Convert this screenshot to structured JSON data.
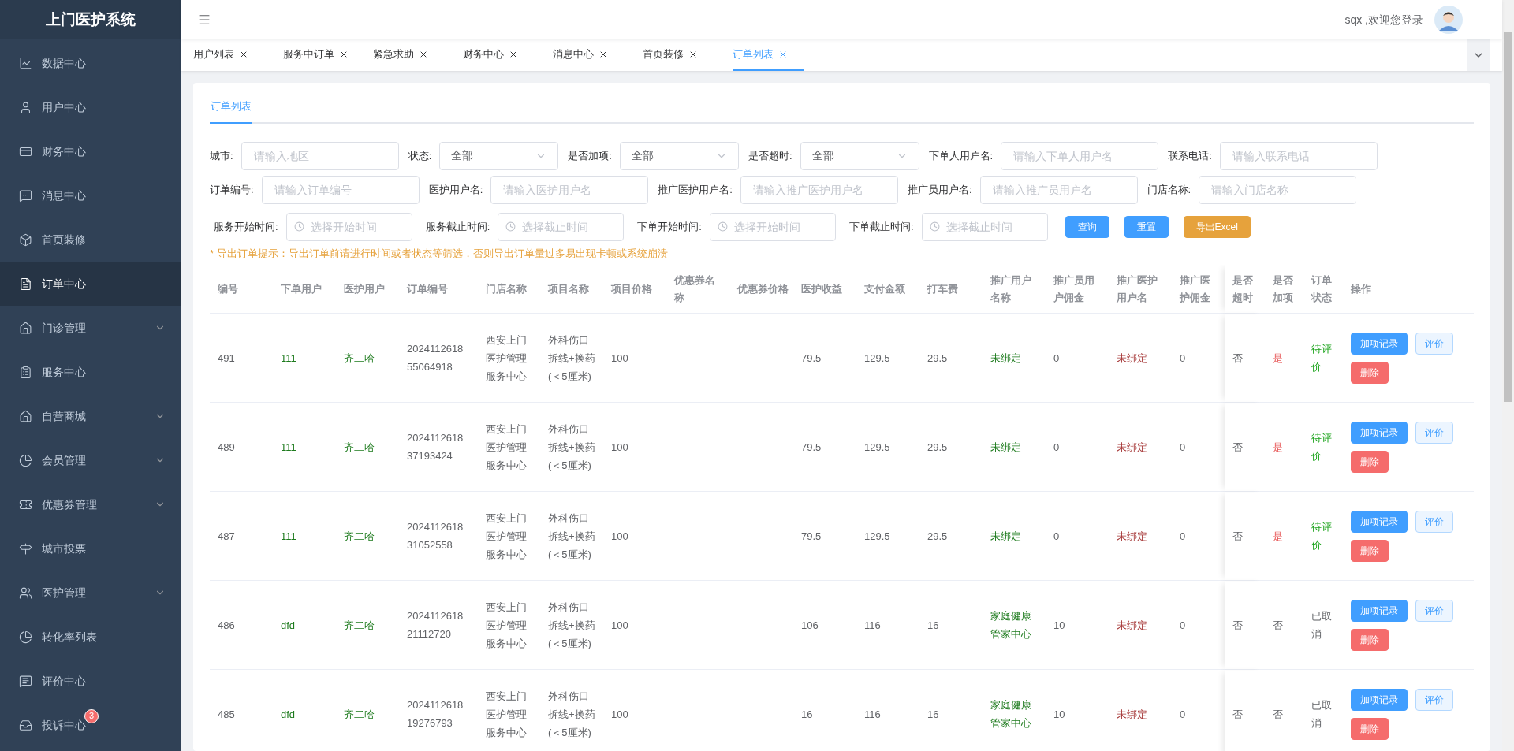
{
  "sidebar": {
    "title": "上门医护系统",
    "items": [
      {
        "label": "数据中心",
        "selected": false,
        "expandable": false
      },
      {
        "label": "用户中心",
        "selected": false,
        "expandable": false
      },
      {
        "label": "财务中心",
        "selected": false,
        "expandable": false
      },
      {
        "label": "消息中心",
        "selected": false,
        "expandable": false
      },
      {
        "label": "首页装修",
        "selected": false,
        "expandable": false
      },
      {
        "label": "订单中心",
        "selected": true,
        "expandable": false
      },
      {
        "label": "门诊管理",
        "selected": false,
        "expandable": true
      },
      {
        "label": "服务中心",
        "selected": false,
        "expandable": false
      },
      {
        "label": "自营商城",
        "selected": false,
        "expandable": true
      },
      {
        "label": "会员管理",
        "selected": false,
        "expandable": true
      },
      {
        "label": "优惠券管理",
        "selected": false,
        "expandable": true
      },
      {
        "label": "城市投票",
        "selected": false,
        "expandable": false
      },
      {
        "label": "医护管理",
        "selected": false,
        "expandable": true
      },
      {
        "label": "转化率列表",
        "selected": false,
        "expandable": false
      },
      {
        "label": "评价中心",
        "selected": false,
        "expandable": false
      },
      {
        "label": "投诉中心",
        "selected": false,
        "expandable": false,
        "badge": "3"
      }
    ]
  },
  "header": {
    "welcome": "sqx ,欢迎您登录"
  },
  "tabs": [
    {
      "label": "用户列表",
      "selected": false
    },
    {
      "label": "服务中订单",
      "selected": false
    },
    {
      "label": "紧急求助",
      "selected": false
    },
    {
      "label": "财务中心",
      "selected": false
    },
    {
      "label": "消息中心",
      "selected": false
    },
    {
      "label": "首页装修",
      "selected": false
    },
    {
      "label": "订单列表",
      "selected": true
    }
  ],
  "panel_tab": {
    "label": "订单列表",
    "selected": true
  },
  "filters": [
    [
      {
        "label": "城市:",
        "kind": "text",
        "placeholder": "请输入地区"
      },
      {
        "label": "状态:",
        "kind": "select",
        "value": "全部"
      },
      {
        "label": "是否加项:",
        "kind": "select",
        "value": "全部"
      },
      {
        "label": "是否超时:",
        "kind": "select",
        "value": "全部"
      },
      {
        "label": "下单人用户名:",
        "kind": "text",
        "placeholder": "请输入下单人用户名"
      },
      {
        "label": "联系电话:",
        "kind": "text",
        "placeholder": "请输入联系电话"
      }
    ],
    [
      {
        "label": "订单编号:",
        "kind": "text",
        "placeholder": "请输入订单编号"
      },
      {
        "label": "医护用户名:",
        "kind": "text",
        "placeholder": "请输入医护用户名"
      },
      {
        "label": "推广医护用户名:",
        "kind": "text",
        "placeholder": "请输入推广医护用户名"
      },
      {
        "label": "推广员用户名:",
        "kind": "text",
        "placeholder": "请输入推广员用户名"
      },
      {
        "label": "门店名称:",
        "kind": "text",
        "placeholder": "请输入门店名称"
      }
    ],
    [
      {
        "label": "服务开始时间:",
        "kind": "date",
        "placeholder": "选择开始时间"
      },
      {
        "label": "服务截止时间:",
        "kind": "date",
        "placeholder": "选择截止时间"
      },
      {
        "label": "下单开始时间:",
        "kind": "date",
        "placeholder": "选择开始时间"
      },
      {
        "label": "下单截止时间:",
        "kind": "date",
        "placeholder": "选择截止时间"
      }
    ]
  ],
  "filter_buttons": [
    {
      "label": "查询",
      "kind": "primary"
    },
    {
      "label": "重置",
      "kind": "primary"
    },
    {
      "label": "导出Excel",
      "kind": "warning"
    }
  ],
  "notice": "* 导出订单提示：导出订单前请进行时间或者状态等筛选，否则导出订单量过多易出现卡顿或系统崩溃",
  "table": {
    "columns": [
      "编号",
      "下单用户",
      "医护用户",
      "订单编号",
      "门店名称",
      "项目名称",
      "项目价格",
      "优惠券名称",
      "优惠券价格",
      "医护收益",
      "支付金额",
      "打车费",
      "推广用户名称",
      "推广员用户佣金",
      "推广医护用户名",
      "推广医护佣金",
      "是否超时",
      "是否加项",
      "订单状态",
      "操作"
    ],
    "rows": [
      {
        "cells": [
          {
            "text": "491"
          },
          {
            "text": "111",
            "color": "#1e7b1e"
          },
          {
            "text": "齐二哈",
            "color": "#1e7b1e"
          },
          {
            "text": "2024112618 55064918"
          },
          {
            "text": "西安上门医护管理服务中心"
          },
          {
            "text": "外科伤口拆线+换药(＜5厘米)"
          },
          {
            "text": "100"
          },
          {
            "text": ""
          },
          {
            "text": ""
          },
          {
            "text": "79.5"
          },
          {
            "text": "129.5"
          },
          {
            "text": "29.5"
          },
          {
            "text": "未绑定",
            "color": "#1e7b1e"
          },
          {
            "text": "0"
          },
          {
            "text": "未绑定",
            "color": "#a83c3c"
          },
          {
            "text": "0"
          },
          {
            "text": "否"
          },
          {
            "text": "是",
            "color": "#e85b5b"
          },
          {
            "text": "待评价",
            "color": "#1aa31a"
          }
        ],
        "actions": [
          {
            "label": "加项记录",
            "kind": "primary"
          },
          {
            "label": "评价",
            "kind": "plain"
          },
          {
            "label": "删除",
            "kind": "danger"
          }
        ]
      },
      {
        "cells": [
          {
            "text": "489"
          },
          {
            "text": "111",
            "color": "#1e7b1e"
          },
          {
            "text": "齐二哈",
            "color": "#1e7b1e"
          },
          {
            "text": "2024112618 37193424"
          },
          {
            "text": "西安上门医护管理服务中心"
          },
          {
            "text": "外科伤口拆线+换药(＜5厘米)"
          },
          {
            "text": "100"
          },
          {
            "text": ""
          },
          {
            "text": ""
          },
          {
            "text": "79.5"
          },
          {
            "text": "129.5"
          },
          {
            "text": "29.5"
          },
          {
            "text": "未绑定",
            "color": "#1e7b1e"
          },
          {
            "text": "0"
          },
          {
            "text": "未绑定",
            "color": "#a83c3c"
          },
          {
            "text": "0"
          },
          {
            "text": "否"
          },
          {
            "text": "是",
            "color": "#e85b5b"
          },
          {
            "text": "待评价",
            "color": "#1aa31a"
          }
        ],
        "actions": [
          {
            "label": "加项记录",
            "kind": "primary"
          },
          {
            "label": "评价",
            "kind": "plain"
          },
          {
            "label": "删除",
            "kind": "danger"
          }
        ]
      },
      {
        "cells": [
          {
            "text": "487"
          },
          {
            "text": "111",
            "color": "#1e7b1e"
          },
          {
            "text": "齐二哈",
            "color": "#1e7b1e"
          },
          {
            "text": "2024112618 31052558"
          },
          {
            "text": "西安上门医护管理服务中心"
          },
          {
            "text": "外科伤口拆线+换药(＜5厘米)"
          },
          {
            "text": "100"
          },
          {
            "text": ""
          },
          {
            "text": ""
          },
          {
            "text": "79.5"
          },
          {
            "text": "129.5"
          },
          {
            "text": "29.5"
          },
          {
            "text": "未绑定",
            "color": "#1e7b1e"
          },
          {
            "text": "0"
          },
          {
            "text": "未绑定",
            "color": "#a83c3c"
          },
          {
            "text": "0"
          },
          {
            "text": "否"
          },
          {
            "text": "是",
            "color": "#e85b5b"
          },
          {
            "text": "待评价",
            "color": "#1aa31a"
          }
        ],
        "actions": [
          {
            "label": "加项记录",
            "kind": "primary"
          },
          {
            "label": "评价",
            "kind": "plain"
          },
          {
            "label": "删除",
            "kind": "danger"
          }
        ]
      },
      {
        "cells": [
          {
            "text": "486"
          },
          {
            "text": "dfd",
            "color": "#1e7b1e"
          },
          {
            "text": "齐二哈",
            "color": "#1e7b1e"
          },
          {
            "text": "2024112618 21112720"
          },
          {
            "text": "西安上门医护管理服务中心"
          },
          {
            "text": "外科伤口拆线+换药(＜5厘米)"
          },
          {
            "text": "100"
          },
          {
            "text": ""
          },
          {
            "text": ""
          },
          {
            "text": "106"
          },
          {
            "text": "116"
          },
          {
            "text": "16"
          },
          {
            "text": "家庭健康管家中心",
            "color": "#1e7b1e"
          },
          {
            "text": "10"
          },
          {
            "text": "未绑定",
            "color": "#a83c3c"
          },
          {
            "text": "0"
          },
          {
            "text": "否"
          },
          {
            "text": "否"
          },
          {
            "text": "已取消"
          }
        ],
        "actions": [
          {
            "label": "加项记录",
            "kind": "primary"
          },
          {
            "label": "评价",
            "kind": "plain"
          },
          {
            "label": "删除",
            "kind": "danger"
          }
        ]
      },
      {
        "cells": [
          {
            "text": "485"
          },
          {
            "text": "dfd",
            "color": "#1e7b1e"
          },
          {
            "text": "齐二哈",
            "color": "#1e7b1e"
          },
          {
            "text": "2024112618 19276793"
          },
          {
            "text": "西安上门医护管理服务中心"
          },
          {
            "text": "外科伤口拆线+换药(＜5厘米)"
          },
          {
            "text": "100"
          },
          {
            "text": ""
          },
          {
            "text": ""
          },
          {
            "text": "16"
          },
          {
            "text": "116"
          },
          {
            "text": "16"
          },
          {
            "text": "家庭健康管家中心",
            "color": "#1e7b1e"
          },
          {
            "text": "10"
          },
          {
            "text": "未绑定",
            "color": "#a83c3c"
          },
          {
            "text": "0"
          },
          {
            "text": "否"
          },
          {
            "text": "否"
          },
          {
            "text": "已取消"
          }
        ],
        "actions": [
          {
            "label": "加项记录",
            "kind": "primary"
          },
          {
            "label": "评价",
            "kind": "plain"
          },
          {
            "label": "删除",
            "kind": "danger"
          }
        ]
      }
    ]
  }
}
